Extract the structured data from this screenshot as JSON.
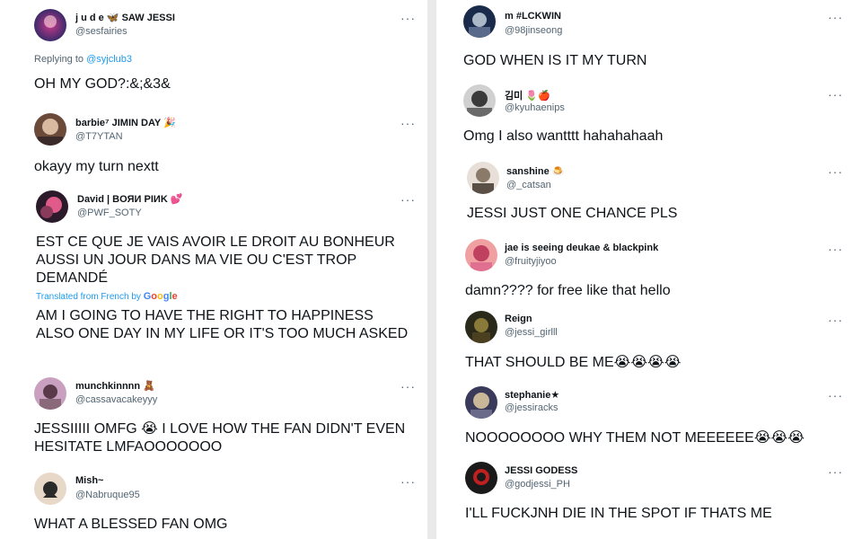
{
  "more_glyph": "···",
  "left": [
    {
      "name": "j u d e 🦋 SAW JESSI",
      "handle": "@sesfairies",
      "reply_prefix": "Replying to",
      "reply_to": "@syjclub3",
      "text": "OH MY GOD?:&;&3&",
      "avatar_colors": [
        "#3b2a6b",
        "#c83a8a"
      ]
    },
    {
      "name": "barbie⁷ JIMIN DAY 🎉",
      "handle": "@T7YTAN",
      "text": "okayy my turn nextt",
      "avatar_colors": [
        "#d9b9a0",
        "#6b4a3a"
      ]
    },
    {
      "name": "David | BOЯИ PIИK 💕",
      "handle": "@PWF_SOTY",
      "text": "EST CE QUE JE VAIS AVOIR LE DROIT AU BONHEUR AUSSI UN JOUR DANS MA VIE OU C'EST TROP DEMANDÉ",
      "translated_label": "Translated from French by",
      "google": [
        "G",
        "o",
        "o",
        "g",
        "l",
        "e"
      ],
      "translation": "AM I GOING TO HAVE THE RIGHT TO HAPPINESS ALSO ONE DAY IN MY LIFE OR IT'S TOO MUCH ASKED",
      "avatar_colors": [
        "#2a1a2a",
        "#e05a8a"
      ]
    },
    {
      "name": "munchkinnnn 🧸",
      "handle": "@cassavacakeyyy",
      "text": "JESSIIIII OMFG 😭 I LOVE HOW THE FAN DIDN'T EVEN HESITATE LMFAOOOOOOO",
      "avatar_colors": [
        "#c9a0c0",
        "#5a3a4a"
      ]
    },
    {
      "name": "Mish~",
      "handle": "@Nabruque95",
      "text": "WHAT A BLESSED FAN OMG",
      "avatar_colors": [
        "#e8d8c8",
        "#2a2a2a"
      ]
    }
  ],
  "right": [
    {
      "name": "m #LCKWIN",
      "handle": "@98jinseong",
      "text": "GOD WHEN IS IT MY TURN",
      "avatar_colors": [
        "#1a2a4a",
        "#aab8c8"
      ]
    },
    {
      "name": "김미 🌷🍎",
      "handle": "@kyuhaenips",
      "text": "Omg I also wantttt hahahahaah",
      "avatar_colors": [
        "#d0d0d0",
        "#3a3a3a"
      ]
    },
    {
      "name": "sanshine 🍮",
      "handle": "@_catsan",
      "text": "JESSI JUST ONE CHANCE PLS",
      "avatar_colors": [
        "#e8e0d8",
        "#8a7a6a"
      ]
    },
    {
      "name": "jae is seeing deukae & blackpink",
      "handle": "@fruityjiyoo",
      "text": "damn???? for free like that hello",
      "avatar_colors": [
        "#f0a0a0",
        "#c04060"
      ]
    },
    {
      "name": "Reign",
      "handle": "@jessi_girlll",
      "text": "THAT SHOULD BE ME😭😭😭😭",
      "avatar_colors": [
        "#2a2a1a",
        "#8a7a3a"
      ]
    },
    {
      "name": "stephanie★",
      "handle": "@jessiracks",
      "text": "NOOOOOOOO WHY THEM NOT MEEEEEE😭😭😭",
      "avatar_colors": [
        "#c8b898",
        "#3a3a5a"
      ]
    },
    {
      "name": "JESSI GODESS",
      "handle": "@godjessi_PH",
      "text": "I'LL FUCKJNH DIE IN THE SPOT IF THATS ME",
      "avatar_colors": [
        "#1a1a1a",
        "#c02020"
      ]
    }
  ]
}
